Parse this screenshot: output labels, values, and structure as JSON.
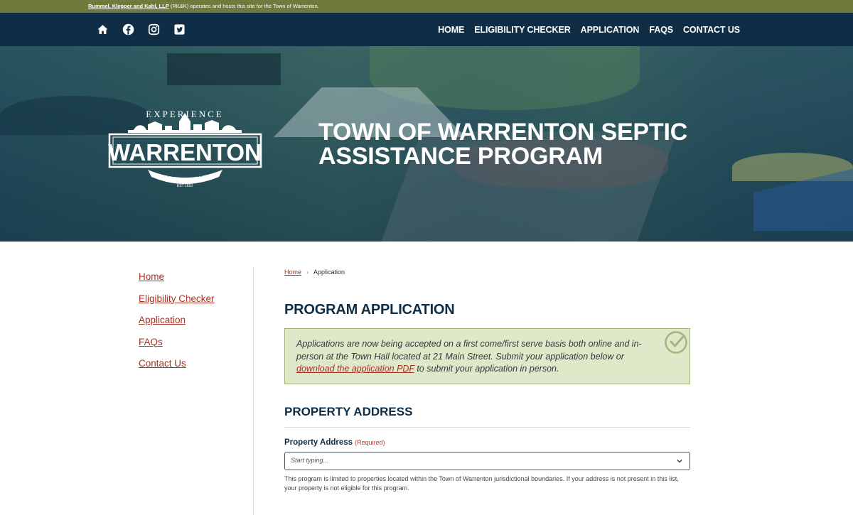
{
  "topbar": {
    "firm": "Rummel, Klepper and Kahl, LLP",
    "rest": " (RK&K) operates and hosts this site for the Town of Warrenton."
  },
  "nav": {
    "social": [
      "home-icon",
      "facebook-icon",
      "instagram-icon",
      "twitter-icon"
    ],
    "menu": [
      "HOME",
      "ELIGIBILITY CHECKER",
      "APPLICATION",
      "FAQS",
      "CONTACT US"
    ]
  },
  "hero": {
    "logo": {
      "top": "EXPERIENCE",
      "main": "WARRENTON",
      "sub": "VIRGINIA",
      "est": "EST 1810"
    },
    "title_line1": "TOWN OF WARRENTON SEPTIC",
    "title_line2": "ASSISTANCE PROGRAM"
  },
  "sidebar": {
    "items": [
      "Home",
      "Eligibility Checker",
      "Application",
      "FAQs",
      "Contact Us"
    ]
  },
  "breadcrumb": {
    "home": "Home",
    "sep": "›",
    "current": "Application"
  },
  "main": {
    "title": "PROGRAM APPLICATION",
    "notice": {
      "text1": "Applications are now being accepted on a first come/first serve basis both online and in-person at the Town Hall located at 21 Main Street. Submit your application below or ",
      "link": "download the application PDF",
      "text2": " to submit your application in person."
    },
    "section_title": "PROPERTY ADDRESS",
    "field": {
      "label": "Property Address",
      "required": "(Required)",
      "placeholder": "Start typing...",
      "help": "This program is limited to properties located within the Town of Warrenton jurisdictional boundaries. If your address is not present in this list, your property is not eligible for this program."
    }
  },
  "colors": {
    "topbar": "#6f7a3d",
    "navbar": "#0f2d44",
    "link": "#a83224",
    "notice_bg": "#dfe8c8",
    "notice_border": "#a5b47d",
    "heading": "#0f2d44"
  }
}
